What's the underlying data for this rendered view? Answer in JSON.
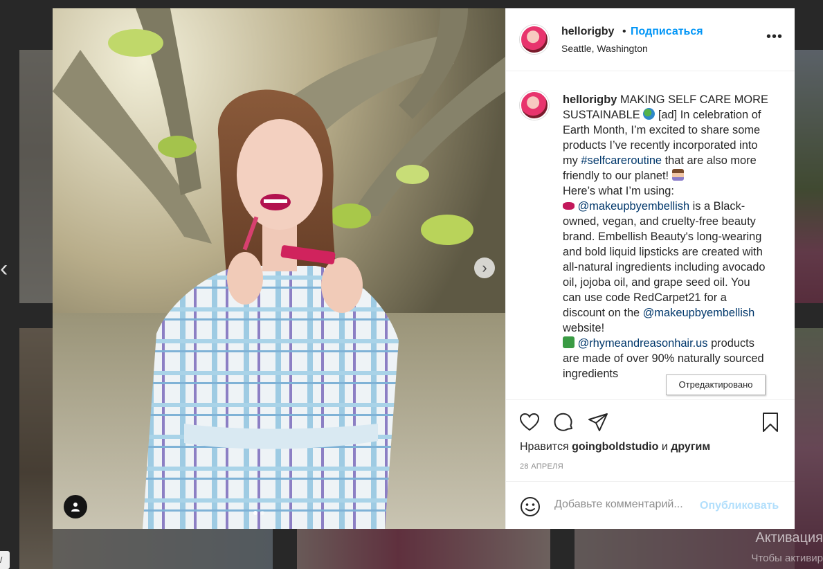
{
  "background": {
    "watermark_title": "Активация",
    "watermark_sub": "Чтобы активир",
    "prev_arrow": "chevron-left-icon",
    "side_tag": "/"
  },
  "post": {
    "username": "hellorigby",
    "dot": "•",
    "follow_label": "Подписаться",
    "location": "Seattle, Washington",
    "more_icon": "more-options-icon",
    "more_glyph": "•••",
    "next_icon": "chevron-right-icon",
    "next_glyph": "›",
    "caption": {
      "username": "hellorigby",
      "p1": "MAKING SELF CARE MORE SUSTAINABLE",
      "p2": "[ad] In celebration of Earth Month, I’m excited to share some products I’ve recently incorporated into my",
      "hashtag": "#selfcareroutine",
      "p3": "that are also more friendly to our planet!",
      "p4": "Here’s what I’m using:",
      "mention1": "@makeupbyembellish",
      "p5": "is a Black-owned, vegan, and cruelty-free beauty brand. Embellish Beauty's long-wearing and bold liquid lipsticks are created with all-natural ingredients including avocado oil, jojoba oil, and grape seed oil. You can use code RedCarpet21 for a discount on the",
      "mention2": "@makeupbyembellish",
      "p6": "website!",
      "mention3": "@rhymeandreasonhair.us",
      "p7": "products are made of over 90% naturally sourced ingredients"
    },
    "tooltip": "Отредактировано",
    "likes": {
      "prefix": "Нравится",
      "user": "goingboldstudio",
      "and": "и",
      "others": "другим"
    },
    "date": "28 АПРЕЛЯ",
    "comment": {
      "placeholder": "Добавьте комментарий...",
      "post_label": "Опубликовать"
    },
    "colors": {
      "follow": "#0095f6",
      "link": "#00376b",
      "post_disabled": "#b2dffc",
      "text": "#262626",
      "muted": "#8e8e8e"
    }
  }
}
